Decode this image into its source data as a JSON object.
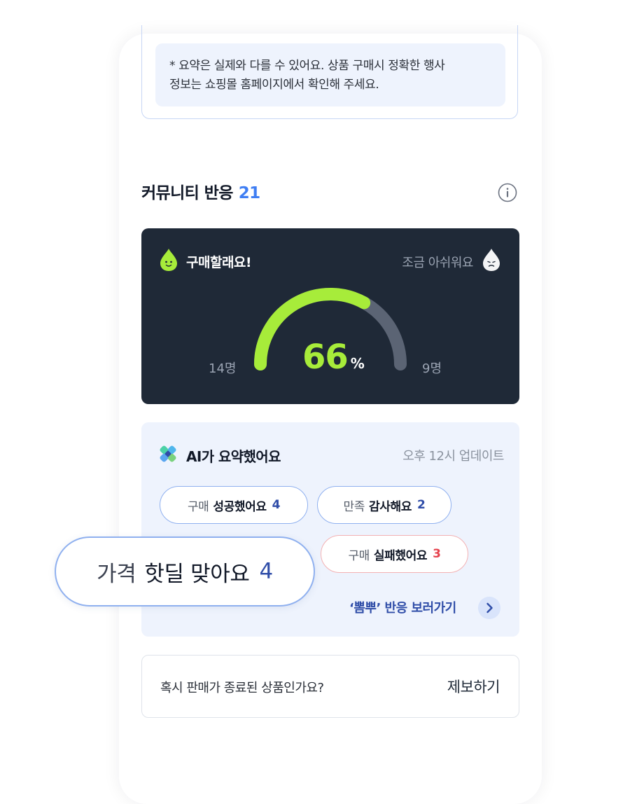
{
  "notice": {
    "line1": "* 요약은 실제와 다를 수 있어요. 상품 구매시 정확한 행사",
    "line2": "정보는 쇼핑몰 홈페이지에서 확인해 주세요."
  },
  "community": {
    "title": "커뮤니티 반응",
    "count": "21",
    "info_icon": "info-circle-icon"
  },
  "gauge": {
    "buy_label": "구매할래요!",
    "regret_label": "조금 아쉬워요",
    "buy_count": "14명",
    "regret_count": "9명",
    "percent": "66",
    "percent_sign": "%",
    "fill_fraction": 0.66,
    "colors": {
      "fill": "#a7ec3a",
      "track": "#5b6474",
      "background": "#1f2937"
    }
  },
  "ai_summary": {
    "title": "AI가 요약했어요",
    "updated": "오후 12시 업데이트",
    "chips": [
      {
        "prefix": "구매",
        "label": "성공했어요",
        "count": "4"
      },
      {
        "prefix": "만족",
        "label": "감사해요",
        "count": "2"
      },
      {
        "prefix": "구매",
        "label": "실패했어요",
        "count": "3"
      },
      {
        "prefix": "가격",
        "label": "핫딜 맞아요",
        "count": "4"
      }
    ],
    "see_more": "‘뽐뿌’ 반응 보러가기"
  },
  "report": {
    "question": "혹시 판매가 종료된 상품인가요?",
    "button": "제보하기"
  }
}
